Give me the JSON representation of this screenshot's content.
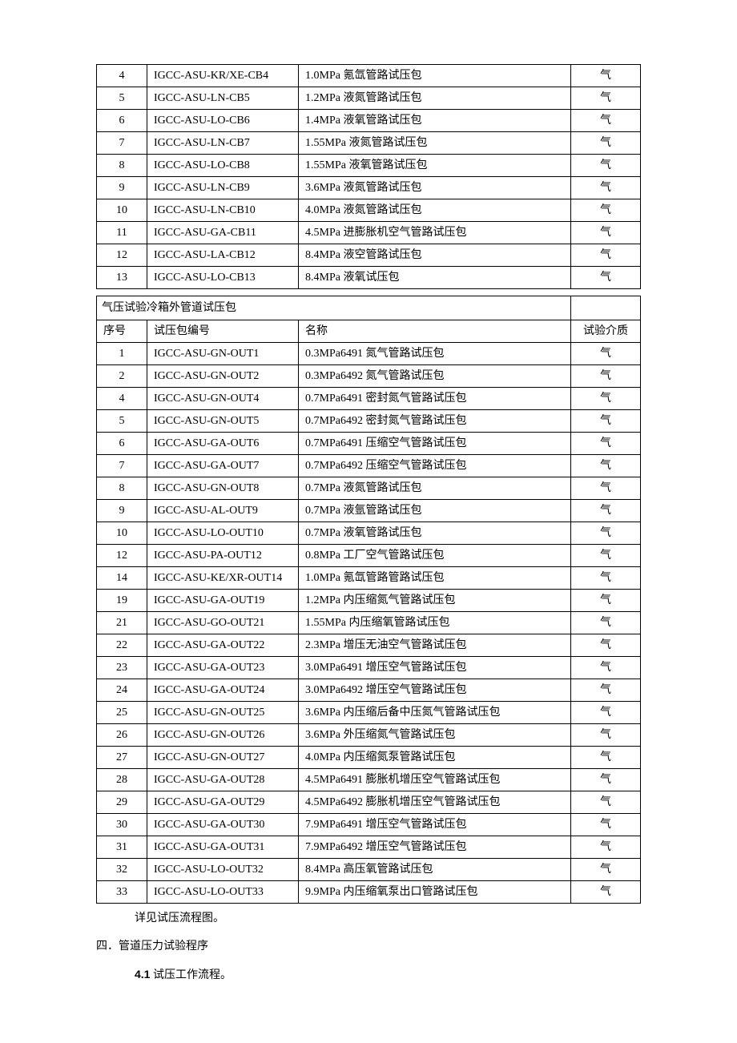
{
  "table1": {
    "rows": [
      {
        "n": "4",
        "code": "IGCC-ASU-KR/XE-CB4",
        "name": "1.0MPa 氪氙管路试压包",
        "m": "气"
      },
      {
        "n": "5",
        "code": "IGCC-ASU-LN-CB5",
        "name": "1.2MPa 液氮管路试压包",
        "m": "气"
      },
      {
        "n": "6",
        "code": "IGCC-ASU-LO-CB6",
        "name": "1.4MPa 液氧管路试压包",
        "m": "气"
      },
      {
        "n": "7",
        "code": "IGCC-ASU-LN-CB7",
        "name": "1.55MPa 液氮管路试压包",
        "m": "气"
      },
      {
        "n": "8",
        "code": "IGCC-ASU-LO-CB8",
        "name": "1.55MPa 液氧管路试压包",
        "m": "气"
      },
      {
        "n": "9",
        "code": "IGCC-ASU-LN-CB9",
        "name": "3.6MPa 液氮管路试压包",
        "m": "气"
      },
      {
        "n": "10",
        "code": "IGCC-ASU-LN-CB10",
        "name": "4.0MPa 液氮管路试压包",
        "m": "气"
      },
      {
        "n": "11",
        "code": "IGCC-ASU-GA-CB11",
        "name": "4.5MPa 进膨胀机空气管路试压包",
        "m": "气"
      },
      {
        "n": "12",
        "code": "IGCC-ASU-LA-CB12",
        "name": "8.4MPa 液空管路试压包",
        "m": "气"
      },
      {
        "n": "13",
        "code": "IGCC-ASU-LO-CB13",
        "name": "8.4MPa 液氧试压包",
        "m": "气"
      }
    ]
  },
  "table2": {
    "sectionTitle": "气压试验冷箱外管道试压包",
    "headers": {
      "n": "序号",
      "code": "试压包编号",
      "name": "名称",
      "m": "试验介质"
    },
    "rows": [
      {
        "n": "1",
        "code": "IGCC-ASU-GN-OUT1",
        "name": "0.3MPa6491 氮气管路试压包",
        "m": "气"
      },
      {
        "n": "2",
        "code": "IGCC-ASU-GN-OUT2",
        "name": "0.3MPa6492 氮气管路试压包",
        "m": "气"
      },
      {
        "n": "4",
        "code": "IGCC-ASU-GN-OUT4",
        "name": "0.7MPa6491 密封氮气管路试压包",
        "m": "气"
      },
      {
        "n": "5",
        "code": "IGCC-ASU-GN-OUT5",
        "name": "0.7MPa6492 密封氮气管路试压包",
        "m": "气"
      },
      {
        "n": "6",
        "code": "IGCC-ASU-GA-OUT6",
        "name": "0.7MPa6491 压缩空气管路试压包",
        "m": "气"
      },
      {
        "n": "7",
        "code": "IGCC-ASU-GA-OUT7",
        "name": "0.7MPa6492 压缩空气管路试压包",
        "m": "气"
      },
      {
        "n": "8",
        "code": "IGCC-ASU-GN-OUT8",
        "name": "0.7MPa 液氮管路试压包",
        "m": "气"
      },
      {
        "n": "9",
        "code": "IGCC-ASU-AL-OUT9",
        "name": "0.7MPa 液氩管路试压包",
        "m": "气"
      },
      {
        "n": "10",
        "code": "IGCC-ASU-LO-OUT10",
        "name": "0.7MPa 液氧管路试压包",
        "m": "气"
      },
      {
        "n": "12",
        "code": "IGCC-ASU-PA-OUT12",
        "name": "0.8MPa 工厂空气管路试压包",
        "m": "气"
      },
      {
        "n": "14",
        "code": "IGCC-ASU-KE/XR-OUT14",
        "name": "1.0MPa 氪氙管路管路试压包",
        "m": "气"
      },
      {
        "n": "19",
        "code": "IGCC-ASU-GA-OUT19",
        "name": "1.2MPa 内压缩氮气管路试压包",
        "m": "气"
      },
      {
        "n": "21",
        "code": "IGCC-ASU-GO-OUT21",
        "name": "1.55MPa 内压缩氧管路试压包",
        "m": "气"
      },
      {
        "n": "22",
        "code": "IGCC-ASU-GA-OUT22",
        "name": "2.3MPa 增压无油空气管路试压包",
        "m": "气"
      },
      {
        "n": "23",
        "code": "IGCC-ASU-GA-OUT23",
        "name": "3.0MPa6491 增压空气管路试压包",
        "m": "气"
      },
      {
        "n": "24",
        "code": "IGCC-ASU-GA-OUT24",
        "name": "3.0MPa6492 增压空气管路试压包",
        "m": "气"
      },
      {
        "n": "25",
        "code": "IGCC-ASU-GN-OUT25",
        "name": "3.6MPa 内压缩后备中压氮气管路试压包",
        "m": "气"
      },
      {
        "n": "26",
        "code": "IGCC-ASU-GN-OUT26",
        "name": "3.6MPa 外压缩氮气管路试压包",
        "m": "气"
      },
      {
        "n": "27",
        "code": "IGCC-ASU-GN-OUT27",
        "name": "4.0MPa 内压缩氮泵管路试压包",
        "m": "气"
      },
      {
        "n": "28",
        "code": "IGCC-ASU-GA-OUT28",
        "name": "4.5MPa6491 膨胀机增压空气管路试压包",
        "m": "气"
      },
      {
        "n": "29",
        "code": "IGCC-ASU-GA-OUT29",
        "name": "4.5MPa6492 膨胀机增压空气管路试压包",
        "m": "气"
      },
      {
        "n": "30",
        "code": "IGCC-ASU-GA-OUT30",
        "name": "7.9MPa6491 增压空气管路试压包",
        "m": "气"
      },
      {
        "n": "31",
        "code": "IGCC-ASU-GA-OUT31",
        "name": "7.9MPa6492 增压空气管路试压包",
        "m": "气"
      },
      {
        "n": "32",
        "code": "IGCC-ASU-LO-OUT32",
        "name": "8.4MPa 高压氧管路试压包",
        "m": "气"
      },
      {
        "n": "33",
        "code": "IGCC-ASU-LO-OUT33",
        "name": "9.9MPa 内压缩氧泵出口管路试压包",
        "m": "气"
      }
    ]
  },
  "afterText": "详见试压流程图。",
  "section4": {
    "title": "四．管道压力试验程序",
    "sub1_num": "4.1",
    "sub1_text": "  试压工作流程。"
  }
}
